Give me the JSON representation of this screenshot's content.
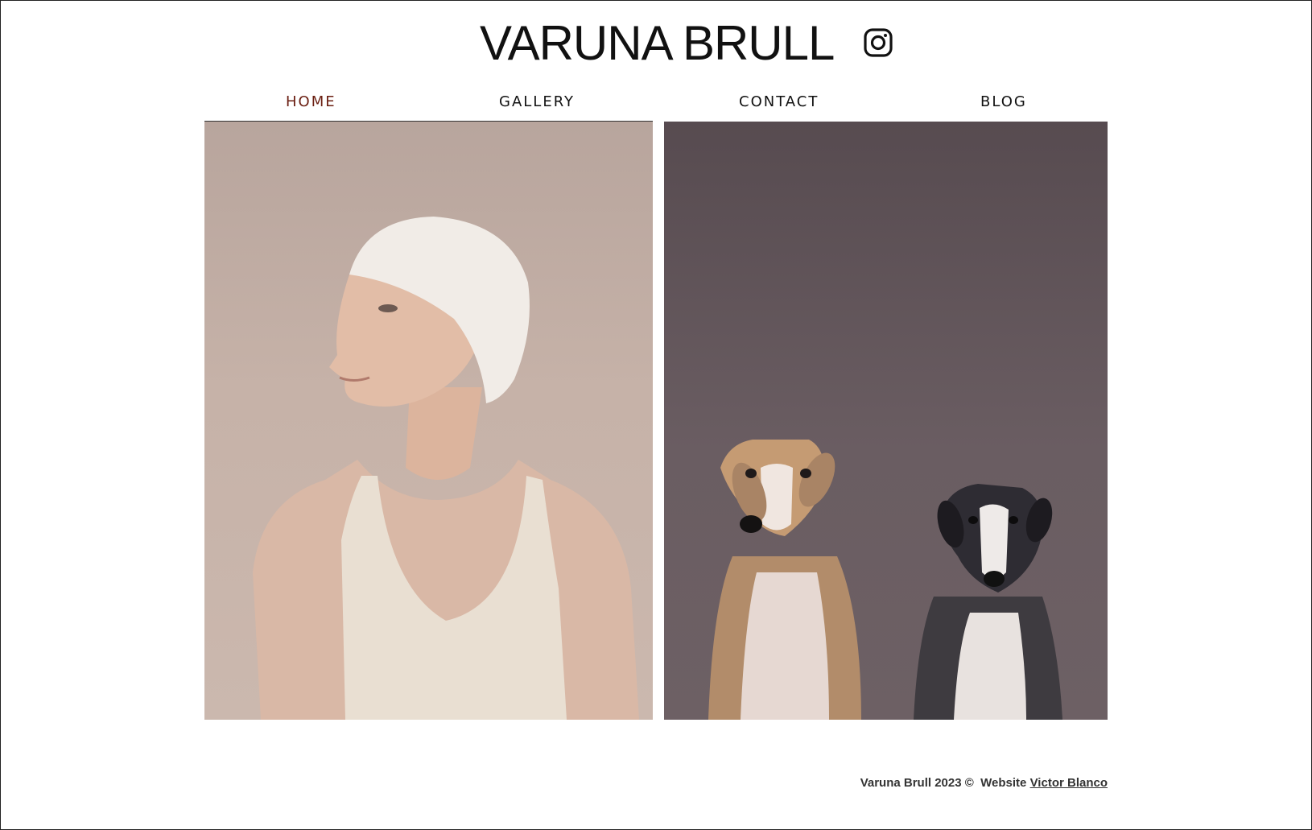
{
  "site": {
    "title": "VARUNA BRULL",
    "social_icon": "instagram-icon"
  },
  "nav": {
    "items": [
      {
        "label": "HOME",
        "active": true
      },
      {
        "label": "GALLERY",
        "active": false
      },
      {
        "label": "CONTACT",
        "active": false
      },
      {
        "label": "BLOG",
        "active": false
      }
    ],
    "active_color": "#6b1f12"
  },
  "photos": {
    "left": {
      "subject": "portrait-photo"
    },
    "right": {
      "subject": "dogs-photo"
    }
  },
  "footer": {
    "copyright": "Varuna Brull 2023 ©",
    "website_prefix": "Website",
    "credit_link": "Victor Blanco"
  }
}
